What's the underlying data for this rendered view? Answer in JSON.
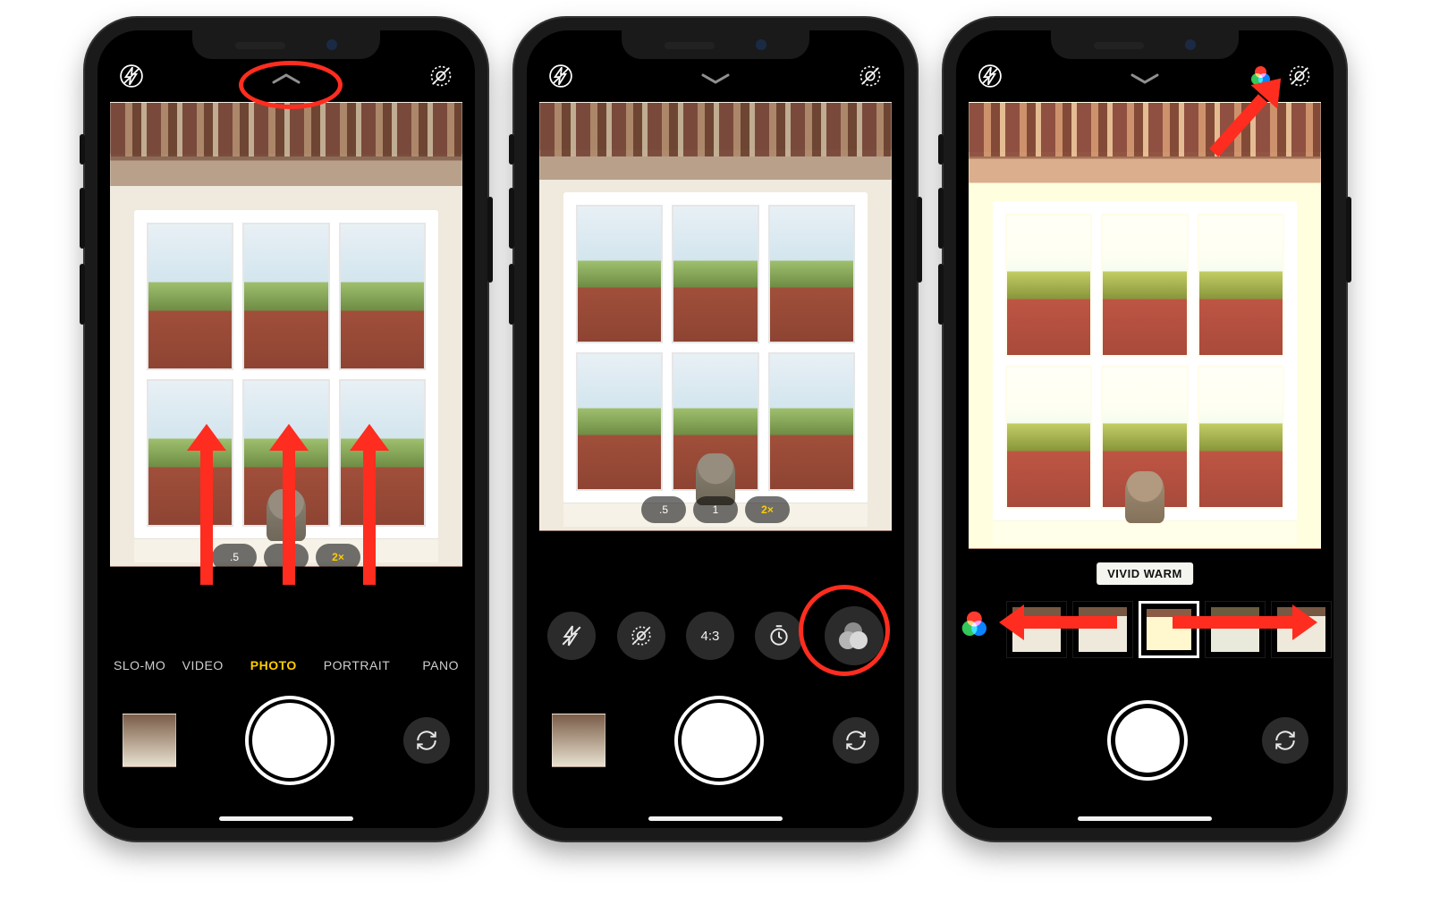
{
  "phone1": {
    "modes": {
      "slomo": "SLO-MO",
      "video": "VIDEO",
      "photo": "PHOTO",
      "portrait": "PORTRAIT",
      "pano": "PANO"
    },
    "zoom": {
      "wide": ".5",
      "one": "1",
      "tele": "2×"
    }
  },
  "phone2": {
    "zoom": {
      "wide": ".5",
      "one": "1",
      "tele": "2×"
    },
    "controls": {
      "aspect": "4:3"
    }
  },
  "phone3": {
    "filter_label": "VIVID WARM"
  }
}
